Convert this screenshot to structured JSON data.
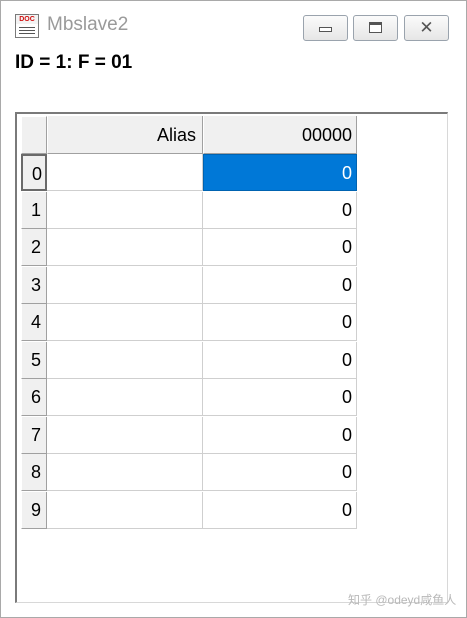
{
  "window": {
    "title": "Mbslave2",
    "app_icon_label": "DOC",
    "minimize_glyph": "",
    "maximize_glyph": "",
    "close_glyph": "✕"
  },
  "status": {
    "line": "ID = 1: F = 01"
  },
  "grid": {
    "columns": [
      "Alias",
      "00000"
    ],
    "rows": [
      {
        "index": "0",
        "alias": "",
        "value": "0"
      },
      {
        "index": "1",
        "alias": "",
        "value": "0"
      },
      {
        "index": "2",
        "alias": "",
        "value": "0"
      },
      {
        "index": "3",
        "alias": "",
        "value": "0"
      },
      {
        "index": "4",
        "alias": "",
        "value": "0"
      },
      {
        "index": "5",
        "alias": "",
        "value": "0"
      },
      {
        "index": "6",
        "alias": "",
        "value": "0"
      },
      {
        "index": "7",
        "alias": "",
        "value": "0"
      },
      {
        "index": "8",
        "alias": "",
        "value": "0"
      },
      {
        "index": "9",
        "alias": "",
        "value": "0"
      }
    ],
    "selected_row": 0
  },
  "colors": {
    "selection": "#0078d7",
    "header_bg": "#f0f0f0",
    "title_text": "#9a9a9a"
  },
  "watermark": "知乎 @odeyd咸鱼人"
}
